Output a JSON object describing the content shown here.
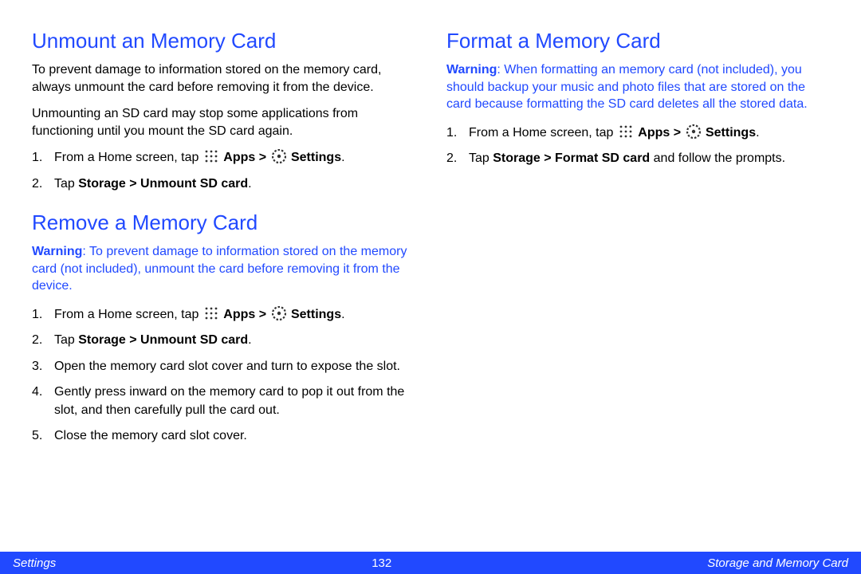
{
  "left": {
    "section1": {
      "heading": "Unmount an Memory Card",
      "para1": "To prevent damage to information stored on the memory card, always unmount the card before removing it from the device.",
      "para2": "Unmounting an SD card may stop some applications from functioning until you mount the SD card again.",
      "step1_pre": "From a Home screen, tap ",
      "step1_apps": "Apps > ",
      "step1_settings": "Settings",
      "step1_post": ".",
      "step2_pre": "Tap ",
      "step2_bold": "Storage > Unmount SD card",
      "step2_post": "."
    },
    "section2": {
      "heading": "Remove a Memory Card",
      "warning_label": "Warning",
      "warning_text": ": To prevent damage to information stored on the memory card (not included), unmount the card before removing it from the device.",
      "step1_pre": "From a Home screen, tap ",
      "step1_apps": "Apps > ",
      "step1_settings": "Settings",
      "step1_post": ".",
      "step2_pre": "Tap ",
      "step2_bold": "Storage > Unmount SD card",
      "step2_post": ".",
      "step3": "Open the memory card slot cover and turn to expose the slot.",
      "step4": "Gently press inward on the memory card to pop it out from the slot, and then carefully pull the card out.",
      "step5": "Close the memory card slot cover."
    }
  },
  "right": {
    "section1": {
      "heading": "Format a Memory Card",
      "warning_label": "Warning",
      "warning_text": ": When formatting an memory card (not included), you should backup your music and photo files that are stored on the card because formatting the SD card deletes all the stored data.",
      "step1_pre": "From a Home screen, tap ",
      "step1_apps": "Apps > ",
      "step1_settings": "Settings",
      "step1_post": ".",
      "step2_pre": "Tap ",
      "step2_bold": "Storage > Format SD card",
      "step2_post": " and follow the prompts."
    }
  },
  "footer": {
    "left": "Settings",
    "center": "132",
    "right": "Storage and Memory Card"
  }
}
